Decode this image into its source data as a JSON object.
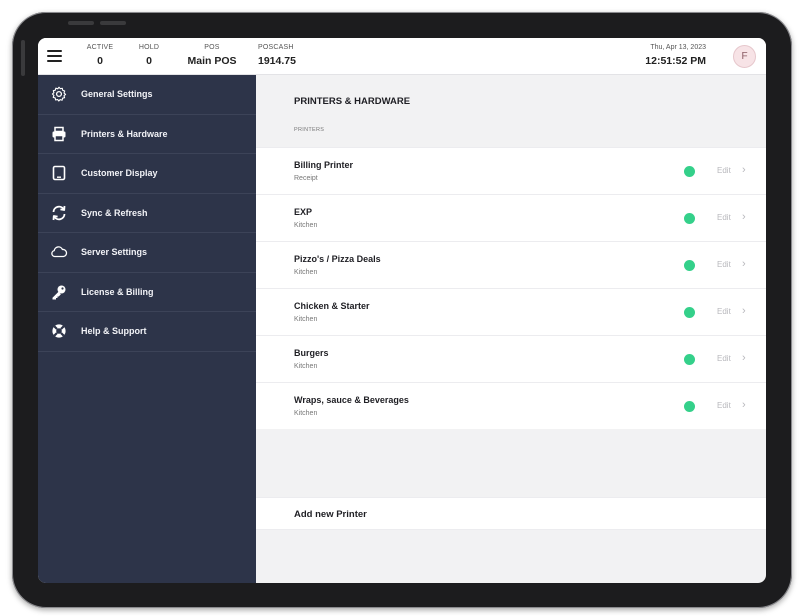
{
  "header": {
    "stats": [
      {
        "label": "ACTIVE",
        "value": "0"
      },
      {
        "label": "HOLD",
        "value": "0"
      },
      {
        "label": "POS",
        "value": "Main POS"
      },
      {
        "label": "POSCASH",
        "value": "1914.75"
      }
    ],
    "date": "Thu, Apr 13, 2023",
    "time": "12:51:52 PM",
    "avatar_initial": "F"
  },
  "sidebar": {
    "items": [
      {
        "label": "General Settings",
        "icon": "gear-icon"
      },
      {
        "label": "Printers & Hardware",
        "icon": "printer-icon"
      },
      {
        "label": "Customer Display",
        "icon": "tablet-icon"
      },
      {
        "label": "Sync & Refresh",
        "icon": "sync-icon"
      },
      {
        "label": "Server Settings",
        "icon": "cloud-icon"
      },
      {
        "label": "License & Billing",
        "icon": "key-icon"
      },
      {
        "label": "Help & Support",
        "icon": "lifebuoy-icon"
      }
    ]
  },
  "main": {
    "title": "PRINTERS & HARDWARE",
    "subtitle": "PRINTERS",
    "printers": [
      {
        "name": "Billing Printer",
        "type": "Receipt"
      },
      {
        "name": "EXP",
        "type": "Kitchen"
      },
      {
        "name": "Pizzo's / Pizza Deals",
        "type": "Kitchen"
      },
      {
        "name": "Chicken & Starter",
        "type": "Kitchen"
      },
      {
        "name": "Burgers",
        "type": "Kitchen"
      },
      {
        "name": "Wraps, sauce & Beverages",
        "type": "Kitchen"
      }
    ],
    "edit_label": "Edit",
    "status_color": "#34d08a",
    "add_label": "Add new Printer"
  },
  "colors": {
    "sidebar_bg": "#2d3449",
    "content_bg": "#f2f2f3"
  }
}
